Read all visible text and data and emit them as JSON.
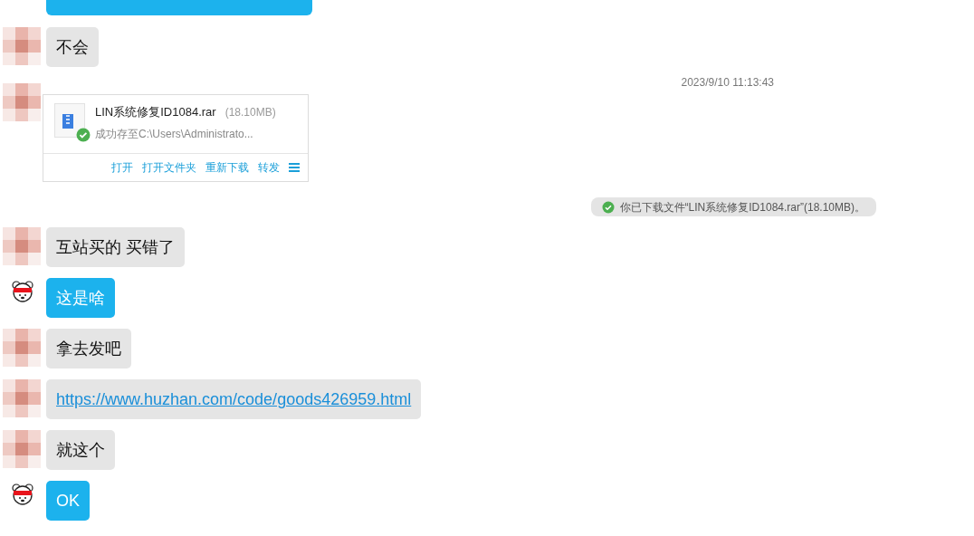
{
  "messages": [
    {
      "kind": "clipped",
      "outgoing": true
    },
    {
      "kind": "text",
      "outgoing": false,
      "text": "不会"
    },
    {
      "kind": "timestamp",
      "text": "2023/9/10 11:13:43"
    },
    {
      "kind": "file",
      "outgoing": false,
      "file_name": "LIN系统修复ID1084.rar",
      "size": "(18.10MB)",
      "status": "成功存至C:\\Users\\Administrato...",
      "actions": [
        "打开",
        "打开文件夹",
        "重新下载",
        "转发"
      ]
    },
    {
      "kind": "notice",
      "text": "你已下载文件“LIN系统修复ID1084.rar”(18.10MB)。"
    },
    {
      "kind": "text",
      "outgoing": false,
      "text": "互站买的 买错了"
    },
    {
      "kind": "text",
      "outgoing": true,
      "text": "这是啥"
    },
    {
      "kind": "text",
      "outgoing": false,
      "text": "拿去发吧"
    },
    {
      "kind": "link",
      "outgoing": false,
      "text": "https://www.huzhan.com/code/goods426959.html"
    },
    {
      "kind": "text",
      "outgoing": false,
      "text": "就这个"
    },
    {
      "kind": "text",
      "outgoing": true,
      "text": "OK"
    }
  ]
}
